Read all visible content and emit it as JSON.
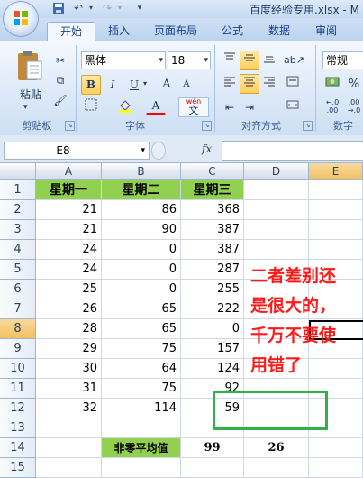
{
  "window": {
    "title": "百度经验专用.xlsx - M"
  },
  "tabs": [
    {
      "label": "开始"
    },
    {
      "label": "插入"
    },
    {
      "label": "页面布局"
    },
    {
      "label": "公式"
    },
    {
      "label": "数据"
    },
    {
      "label": "审阅"
    }
  ],
  "ribbon": {
    "clipboard": {
      "paste_label": "粘贴",
      "group_label": "剪贴板"
    },
    "font": {
      "font_name": "黑体",
      "font_size": "18",
      "group_label": "字体",
      "bold": "B",
      "italic": "I",
      "underline": "U",
      "grow": "A",
      "shrink": "A",
      "font_color": "A",
      "wen": "wén",
      "wen_char": "文"
    },
    "alignment": {
      "group_label": "对齐方式"
    },
    "number": {
      "format": "常规",
      "group_label": "数字"
    }
  },
  "formula_bar": {
    "name_box": "E8",
    "fx": "fx",
    "content": ""
  },
  "grid": {
    "columns": [
      "A",
      "B",
      "C",
      "D",
      "E"
    ],
    "active_column": "E",
    "active_row": 8,
    "rows": [
      {
        "n": "1",
        "a": "星期一",
        "b": "星期二",
        "c": "星期三"
      },
      {
        "n": "2",
        "a": "21",
        "b": "86",
        "c": "368"
      },
      {
        "n": "3",
        "a": "21",
        "b": "90",
        "c": "387"
      },
      {
        "n": "4",
        "a": "24",
        "b": "0",
        "c": "387"
      },
      {
        "n": "5",
        "a": "24",
        "b": "0",
        "c": "287"
      },
      {
        "n": "6",
        "a": "25",
        "b": "0",
        "c": "255"
      },
      {
        "n": "7",
        "a": "26",
        "b": "65",
        "c": "222"
      },
      {
        "n": "8",
        "a": "28",
        "b": "65",
        "c": "0"
      },
      {
        "n": "9",
        "a": "29",
        "b": "75",
        "c": "157"
      },
      {
        "n": "10",
        "a": "30",
        "b": "64",
        "c": "124"
      },
      {
        "n": "11",
        "a": "31",
        "b": "75",
        "c": "92"
      },
      {
        "n": "12",
        "a": "32",
        "b": "114",
        "c": "59"
      },
      {
        "n": "13",
        "a": "",
        "b": "",
        "c": ""
      },
      {
        "n": "14",
        "a": "",
        "b": "非零平均值",
        "c": "99",
        "d": "26"
      },
      {
        "n": "15",
        "a": "",
        "b": "",
        "c": ""
      }
    ]
  },
  "annotation": {
    "lines": [
      "二者差别还",
      "是很大的，",
      "千万不要使",
      "用错了"
    ]
  },
  "colors": {
    "header_fill": "#92d050",
    "annotation": "#ff1a1a",
    "highlight_box": "#2fb24a",
    "active_header": "#f1c15f"
  }
}
